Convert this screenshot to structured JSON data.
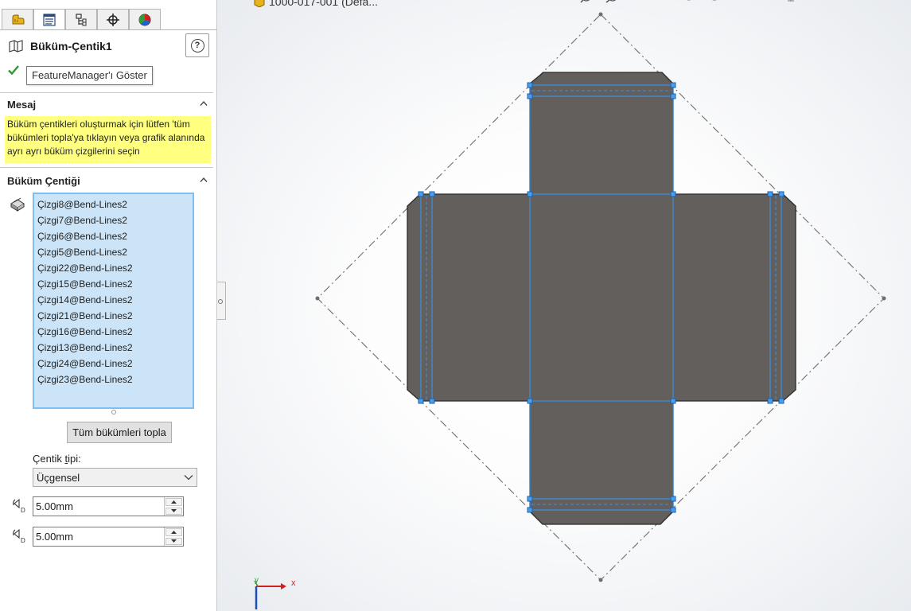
{
  "panel": {
    "tabs": [
      {
        "icon": "feature-manager-icon"
      },
      {
        "icon": "property-manager-icon"
      },
      {
        "icon": "configuration-manager-icon"
      },
      {
        "icon": "dimxpert-icon"
      },
      {
        "icon": "display-manager-icon"
      }
    ],
    "title": "Büküm-Çentik1",
    "help_label": "?",
    "tooltip": "FeatureManager'ı Göster",
    "message_section": {
      "title": "Mesaj",
      "text": "Büküm çentikleri oluşturmak için lütfen 'tüm bükümleri topla'ya tıklayın veya grafik alanında ayrı ayrı büküm çizgilerini seçin"
    },
    "relief_section": {
      "title": "Büküm Çentiği",
      "items": [
        "Çizgi8@Bend-Lines2",
        "Çizgi7@Bend-Lines2",
        "Çizgi6@Bend-Lines2",
        "Çizgi5@Bend-Lines2",
        "Çizgi22@Bend-Lines2",
        "Çizgi15@Bend-Lines2",
        "Çizgi14@Bend-Lines2",
        "Çizgi21@Bend-Lines2",
        "Çizgi16@Bend-Lines2",
        "Çizgi13@Bend-Lines2",
        "Çizgi24@Bend-Lines2",
        "Çizgi23@Bend-Lines2"
      ],
      "collect_button": "Tüm bükümleri topla",
      "type_label": "Çentik tipi:",
      "type_value": "Üçgensel",
      "distance1": "5.00mm",
      "distance2": "5.00mm"
    }
  },
  "viewport": {
    "document_title": "1000-017-001 (Defa...",
    "axis_x_label": "x",
    "axis_y_label": "y",
    "colors": {
      "part_fill": "#635f5c",
      "bend_line": "#3d8fe0",
      "handle": "#4aa0f0",
      "check": "#2e9a2e",
      "message_bg": "#ffff80",
      "list_bg": "#cce4f7"
    }
  }
}
